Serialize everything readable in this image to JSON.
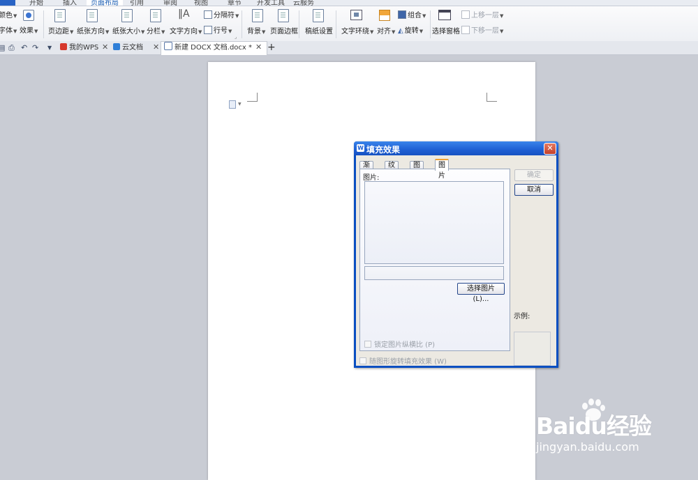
{
  "menu": {
    "tabs": [
      "开始",
      "插入",
      "页面布局",
      "引用",
      "审阅",
      "视图",
      "章节",
      "开发工具",
      "云服务"
    ],
    "active": "页面布局"
  },
  "ribbon": {
    "theme_color": "颜色",
    "theme_font": "字体",
    "theme_effect": "效果",
    "margins": "页边距",
    "orientation": "纸张方向",
    "size": "纸张大小",
    "columns": "分栏",
    "text_direction": "文字方向",
    "breaks": "分隔符",
    "line_numbers": "行号",
    "background": "背景",
    "page_border": "页面边框",
    "draft_setup": "稿纸设置",
    "text_wrap": "文字环绕",
    "align": "对齐",
    "group": "组合",
    "rotate": "旋转",
    "selection_pane": "选择窗格",
    "bring_forward": "上移一层",
    "send_backward": "下移一层"
  },
  "doc_tabs": [
    {
      "label": "我的WPS"
    },
    {
      "label": "云文档"
    },
    {
      "label": "新建 DOCX 文档.docx *"
    }
  ],
  "dialog": {
    "title": "填充效果",
    "close_glyph": "✕",
    "tabs": [
      "渐变",
      "纹理",
      "图案",
      "图片"
    ],
    "active_tab": "图片",
    "picture_label": "图片:",
    "select_picture": "选择图片 (L)...",
    "lock_aspect": "锁定图片纵横比 (P)",
    "rotate_with_shape": "随图形旋转填充效果 (W)",
    "ok": "确定",
    "cancel": "取消",
    "sample_label": "示例:"
  },
  "watermark": {
    "brand": "Baidu经验",
    "url": "jingyan.baidu.com"
  },
  "colors": {
    "dialog_title_blue": "#1e5fd3",
    "ribbon_active": "#1e5fb4",
    "workspace": "#c9ccd4"
  }
}
